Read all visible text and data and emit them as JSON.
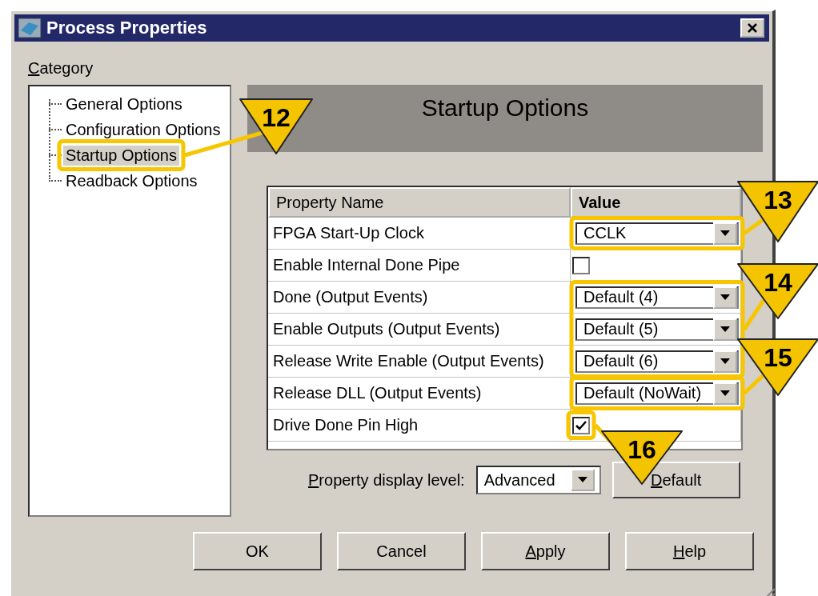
{
  "window": {
    "title": "Process Properties"
  },
  "category": {
    "label": "Category",
    "underline_first": true
  },
  "tree": {
    "items": [
      {
        "label": "General Options",
        "selected": false
      },
      {
        "label": "Configuration Options",
        "selected": false
      },
      {
        "label": "Startup Options",
        "selected": true
      },
      {
        "label": "Readback Options",
        "selected": false
      }
    ]
  },
  "panel_title": "Startup Options",
  "table": {
    "columns": [
      "Property Name",
      "Value"
    ],
    "rows": [
      {
        "name": "FPGA Start-Up Clock",
        "kind": "combo",
        "value": "CCLK"
      },
      {
        "name": "Enable Internal Done Pipe",
        "kind": "checkbox",
        "checked": false
      },
      {
        "name": "Done (Output Events)",
        "kind": "combo",
        "value": "Default (4)"
      },
      {
        "name": "Enable Outputs (Output Events)",
        "kind": "combo",
        "value": "Default (5)"
      },
      {
        "name": "Release Write Enable (Output Events)",
        "kind": "combo",
        "value": "Default (6)"
      },
      {
        "name": "Release DLL (Output Events)",
        "kind": "combo",
        "value": "Default (NoWait)"
      },
      {
        "name": "Drive Done Pin High",
        "kind": "checkbox",
        "checked": true
      }
    ]
  },
  "display_level": {
    "label": "Property display level:",
    "underline_first": true,
    "value": "Advanced"
  },
  "default_button": {
    "label": "Default",
    "underline_first": true
  },
  "buttons": [
    {
      "label": "OK",
      "underline_first": false
    },
    {
      "label": "Cancel",
      "underline_first": false
    },
    {
      "label": "Apply",
      "underline_first": true
    },
    {
      "label": "Help",
      "underline_first": true
    }
  ],
  "callouts": [
    "12",
    "13",
    "14",
    "15",
    "16"
  ]
}
